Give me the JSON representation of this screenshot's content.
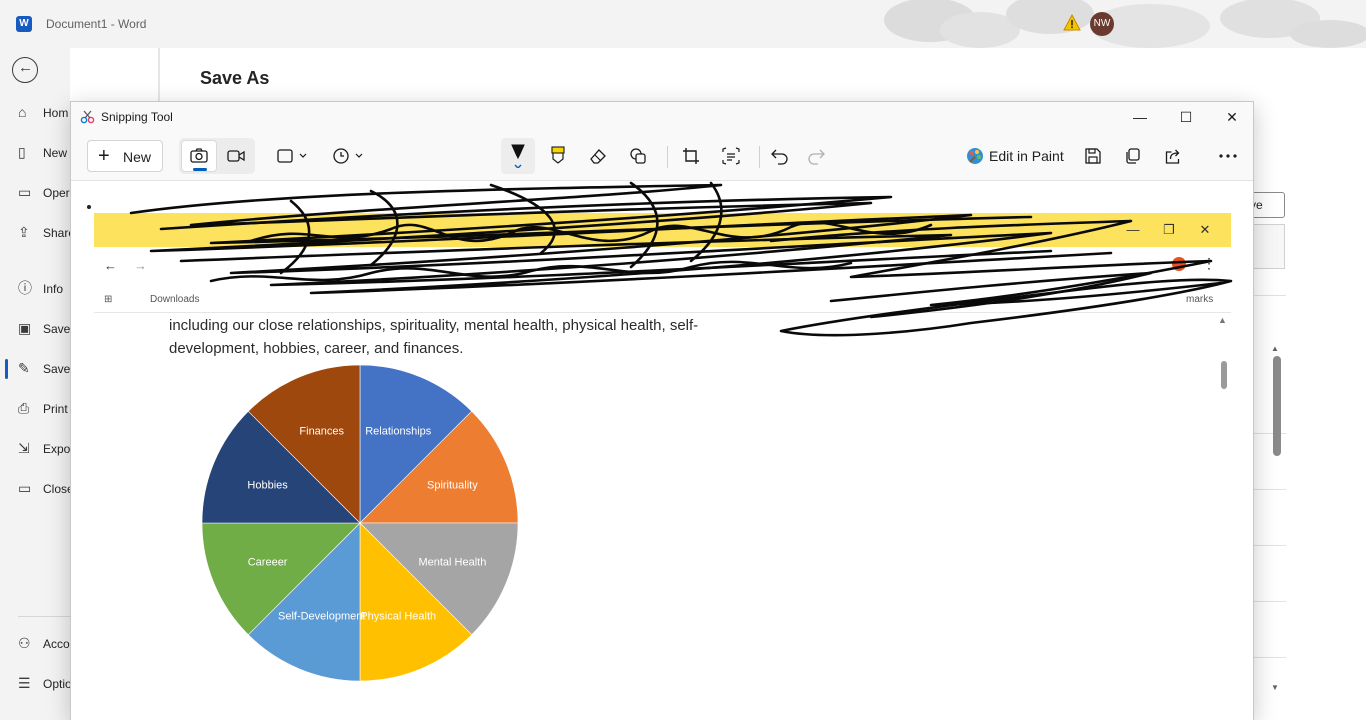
{
  "word": {
    "title": "Document1  -  Word",
    "logo": "W",
    "user_initials": "NW",
    "page_title": "Save As",
    "save_button_partial": "ve",
    "nav": [
      {
        "label": "Hom",
        "icon": "home-icon"
      },
      {
        "label": "New",
        "icon": "new-document-icon"
      },
      {
        "label": "Oper",
        "icon": "open-folder-icon"
      },
      {
        "label": "Share",
        "icon": "share-icon"
      },
      {
        "label": "Info",
        "icon": "info-icon"
      },
      {
        "label": "Save",
        "icon": "save-icon"
      },
      {
        "label": "Save",
        "icon": "save-as-icon"
      },
      {
        "label": "Print",
        "icon": "print-icon"
      },
      {
        "label": "Expo",
        "icon": "export-icon"
      },
      {
        "label": "Close",
        "icon": "close-folder-icon"
      },
      {
        "label": "Acco",
        "icon": "account-icon"
      },
      {
        "label": "Optio",
        "icon": "options-icon"
      }
    ]
  },
  "snipping_tool": {
    "title": "Snipping Tool",
    "new_label": "New",
    "edit_in_paint_label": "Edit in Paint"
  },
  "canvas": {
    "chrome_bookmark_first": "Downloads",
    "chrome_bookmark_last": "marks",
    "page_text": "including our close relationships, spirituality, mental health, physical health, self-development, hobbies, career, and finances."
  },
  "chart_data": {
    "type": "pie",
    "categories": [
      "Relationships",
      "Spirituality",
      "Mental Health",
      "Physical Health",
      "Self-Development",
      "Careeer",
      "Hobbies",
      "Finances"
    ],
    "values": [
      12.5,
      12.5,
      12.5,
      12.5,
      12.5,
      12.5,
      12.5,
      12.5
    ],
    "colors": [
      "#4472c4",
      "#ed7d31",
      "#a5a5a5",
      "#ffc000",
      "#5b9bd5",
      "#70ad47",
      "#264478",
      "#9e480e"
    ]
  }
}
